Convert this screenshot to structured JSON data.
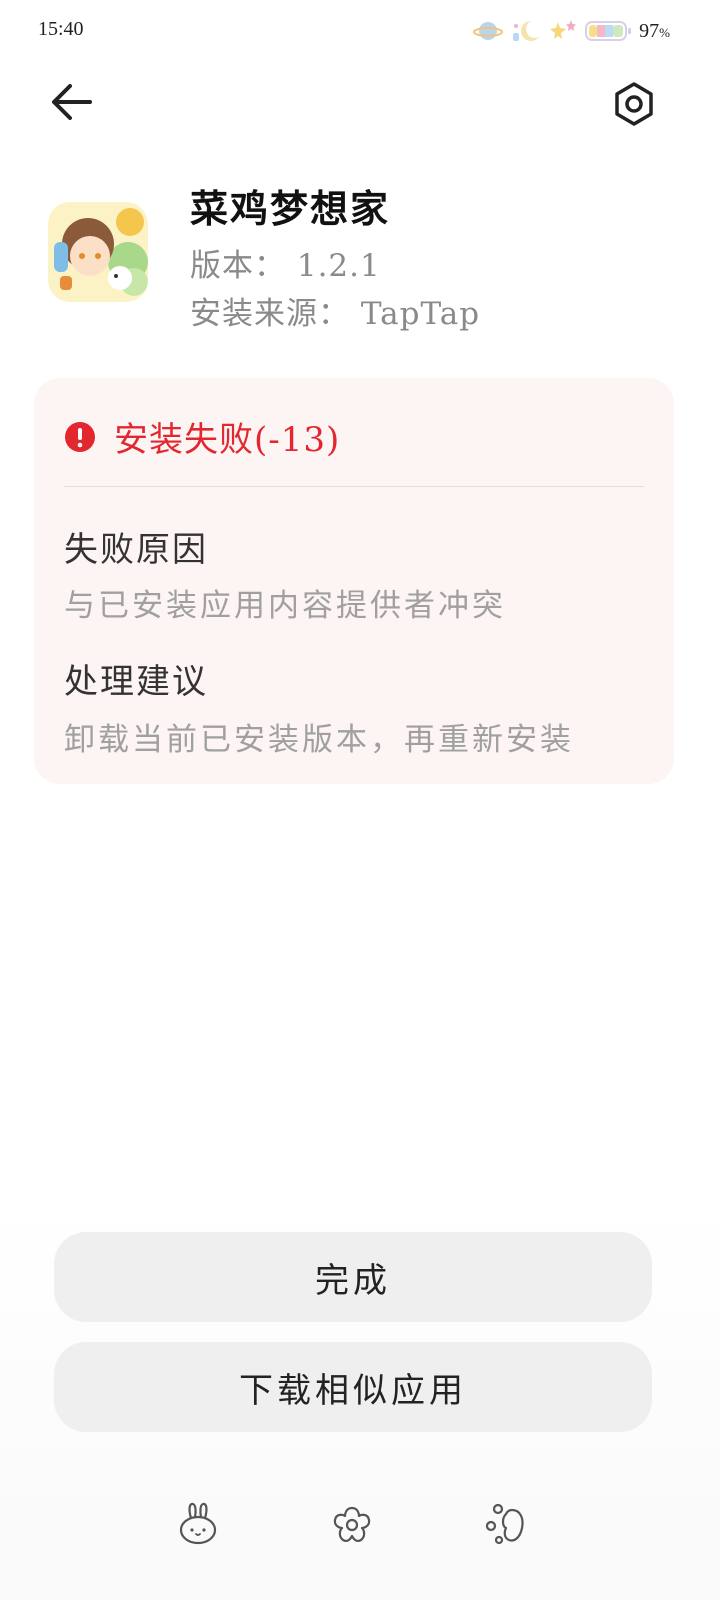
{
  "status_bar": {
    "time": "15:40",
    "battery_percent": "97",
    "battery_unit": "%",
    "icons": [
      "planet-icon",
      "moon-stars-icon",
      "sparkle-stars-icon",
      "battery-icon"
    ]
  },
  "nav": {
    "back_icon": "arrow-left-icon",
    "settings_icon": "hexagon-settings-icon"
  },
  "app": {
    "name": "菜鸡梦想家",
    "version": "版本： 1.2.1",
    "source": "安装来源： TapTap"
  },
  "error": {
    "title": "安装失败(-13)",
    "icon": "exclamation-circle-icon",
    "color": "#e3272f",
    "reason_title": "失败原因",
    "reason_text": "与已安装应用内容提供者冲突",
    "suggestion_title": "处理建议",
    "suggestion_text": "卸载当前已安装版本，再重新安装"
  },
  "buttons": {
    "done": "完成",
    "download_similar": "下载相似应用"
  },
  "bottom_nav": {
    "icons": [
      "bunny-icon",
      "flower-icon",
      "shapes-icon"
    ]
  }
}
